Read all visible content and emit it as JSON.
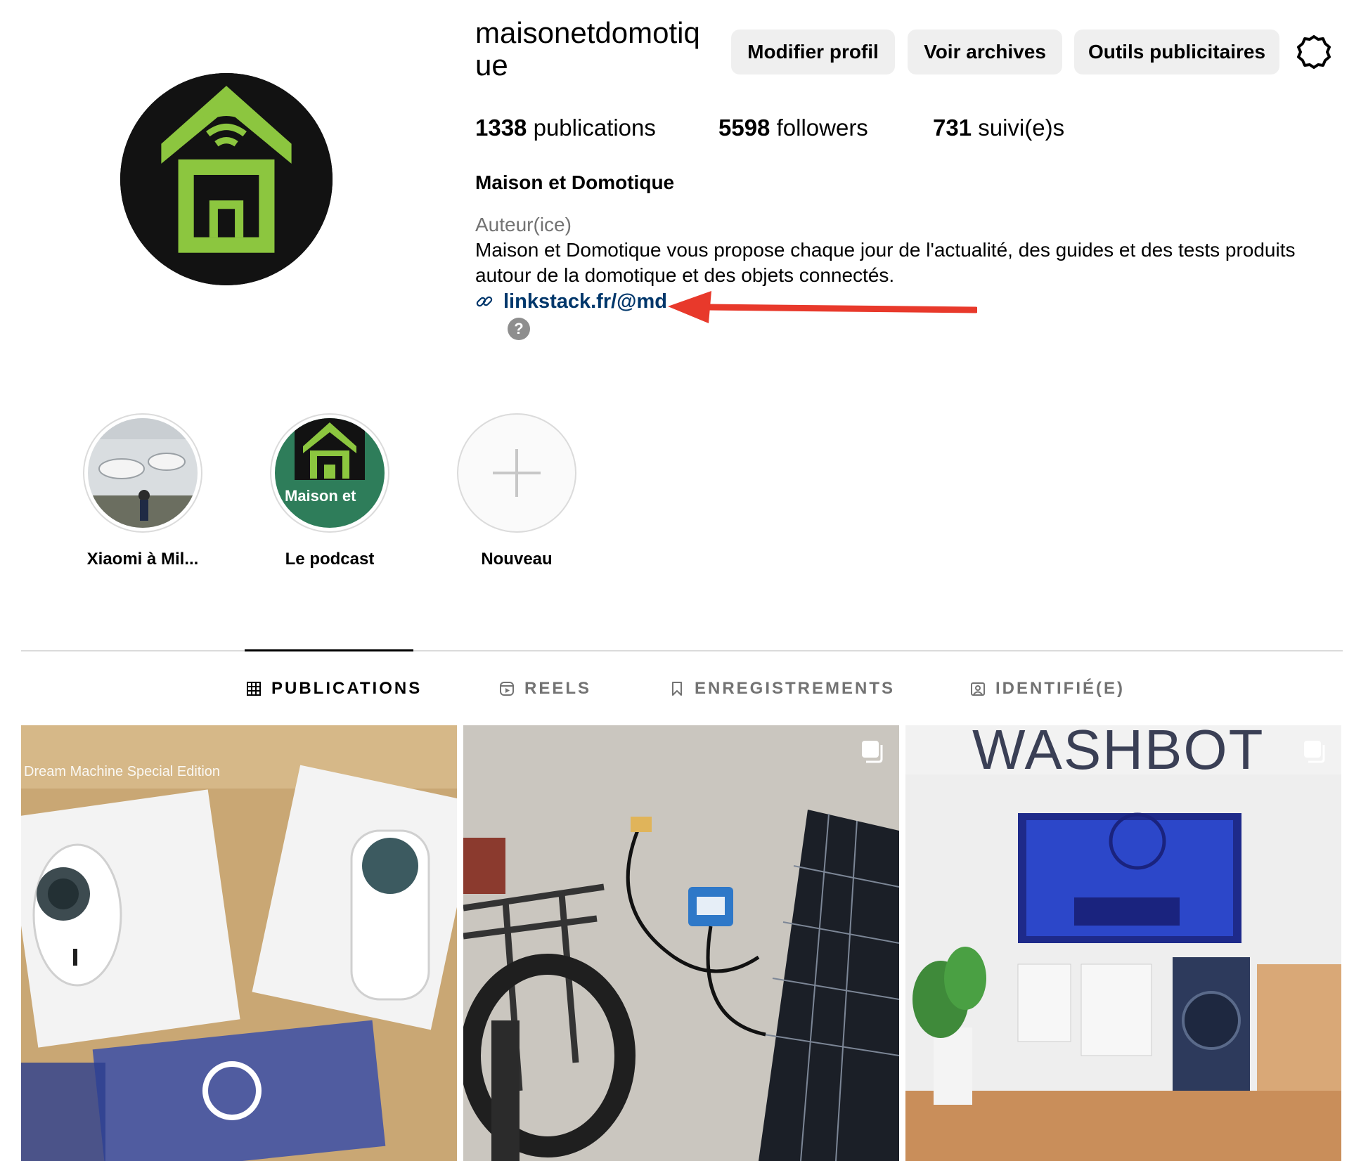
{
  "profile": {
    "username": "maisonetdomotique",
    "full_name": "Maison et Domotique",
    "category": "Auteur(ice)",
    "bio": "Maison et Domotique vous propose chaque jour de l'actualité, des guides et des tests produits autour de la domotique et des objets connectés.",
    "link": "linkstack.fr/@md",
    "help_icon_label": "?"
  },
  "buttons": {
    "edit_profile": "Modifier profil",
    "view_archive": "Voir archives",
    "ad_tools": "Outils publicitaires"
  },
  "stats": {
    "posts_count": "1338",
    "posts_label": " publications",
    "followers_count": "5598",
    "followers_label": " followers",
    "following_count": "731",
    "following_label": " suivi(e)s"
  },
  "highlights": [
    {
      "label": "Xiaomi à Mil..."
    },
    {
      "label": "Le podcast",
      "cover_text": "Maison et"
    },
    {
      "label": "Nouveau"
    }
  ],
  "tabs": [
    {
      "label": "PUBLICATIONS",
      "icon": "grid-icon",
      "active": true
    },
    {
      "label": "REELS",
      "icon": "reels-icon",
      "active": false
    },
    {
      "label": "ENREGISTREMENTS",
      "icon": "bookmark-icon",
      "active": false
    },
    {
      "label": "IDENTIFIÉ(E)",
      "icon": "tagged-icon",
      "active": false
    }
  ],
  "posts": [
    {
      "caption_in_image": "Dream Machine Special Edition",
      "multi": false
    },
    {
      "multi": true
    },
    {
      "caption_in_image": "WASHBOT",
      "multi": true
    }
  ],
  "colors": {
    "brand_green": "#8cc63f",
    "link_blue": "#00376b",
    "annotation_arrow": "#e8392b",
    "button_bg": "#efefef"
  }
}
